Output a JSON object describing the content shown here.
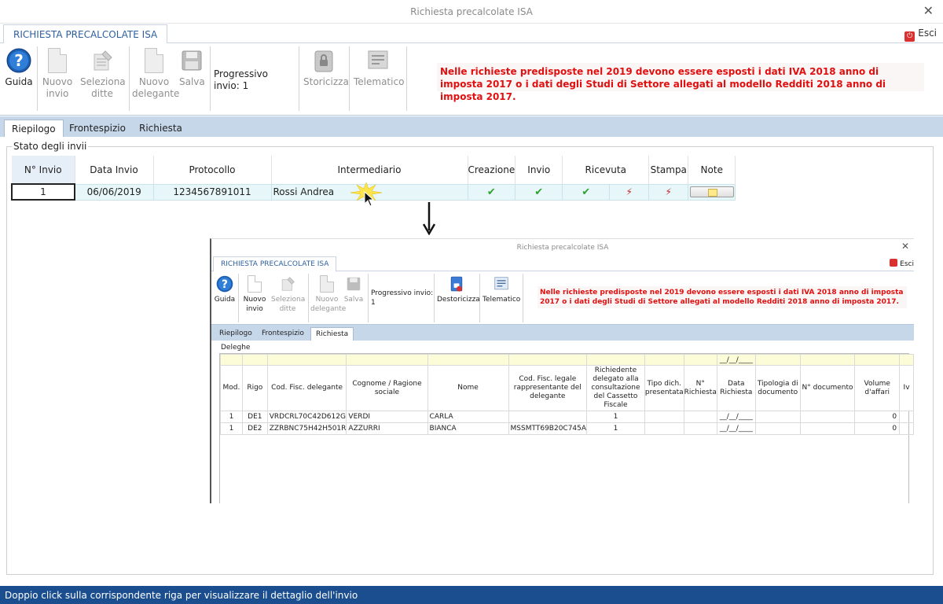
{
  "window": {
    "title": "Richiesta precalcolate ISA",
    "close": "✕"
  },
  "ribbon_tab": "RICHIESTA PRECALCOLATE ISA",
  "exit_label": "Esci",
  "toolbar": {
    "guida": "Guida",
    "nuovo_invio": [
      "Nuovo",
      "invio"
    ],
    "seleziona_ditte": [
      "Seleziona",
      "ditte"
    ],
    "nuovo_delegante": [
      "Nuovo",
      "delegante"
    ],
    "salva": "Salva",
    "progressivo": "Progressivo invio: 1",
    "storicizza": "Storicizza",
    "telematico": "Telematico"
  },
  "warning": "Nelle richieste predisposte nel 2019 devono essere esposti i dati IVA 2018 anno di imposta 2017 o i dati degli Studi di Settore allegati al modello Redditi 2018 anno di imposta 2017.",
  "tabs": [
    "Riepilogo",
    "Frontespizio",
    "Richiesta"
  ],
  "group_label": "Stato degli invii",
  "table": {
    "headers": [
      "N° Invio",
      "Data Invio",
      "Protocollo",
      "Intermediario",
      "Creazione",
      "Invio",
      "Ricevuta",
      "",
      "Stampa",
      "Note"
    ],
    "row": {
      "n": "1",
      "data": "06/06/2019",
      "protocollo": "1234567891011",
      "intermediario": "Rossi Andrea"
    }
  },
  "inner": {
    "title": "Richiesta precalcolate ISA",
    "ribbon_tab": "RICHIESTA PRECALCOLATE ISA",
    "exit_label": "Esci",
    "toolbar": {
      "guida": "Guida",
      "nuovo_invio": [
        "Nuovo",
        "invio"
      ],
      "seleziona_ditte": [
        "Seleziona",
        "ditte"
      ],
      "nuovo_delegante": [
        "Nuovo",
        "delegante"
      ],
      "salva": "Salva",
      "progressivo": "Progressivo invio: 1",
      "destoricizza": "Destoricizza",
      "telematico": "Telematico"
    },
    "warning": "Nelle richieste predisposte nel 2019 devono essere esposti i dati IVA 2018 anno di imposta 2017 o i dati degli Studi di Settore allegati al modello Redditi 2018 anno di imposta 2017.",
    "tabs": [
      "Riepilogo",
      "Frontespizio",
      "Richiesta"
    ],
    "group_label": "Deleghe",
    "date_placeholder": "__/__/____",
    "headers": [
      "Mod.",
      "Rigo",
      "Cod. Fisc. delegante",
      "Cognome / Ragione sociale",
      "Nome",
      "Cod. Fisc. legale rappresentante del delegante",
      "Richiedente delegato alla consultazione del Cassetto Fiscale",
      "Tipo dich. presentata",
      "N° Richiesta",
      "Data Richiesta",
      "Tipologia di documento",
      "N° documento",
      "Volume d'affari",
      "Iv"
    ],
    "rows": [
      {
        "mod": "1",
        "rigo": "DE1",
        "cf": "VRDCRL70C42D612G",
        "cognome": "VERDI",
        "nome": "CARLA",
        "cf_legale": "",
        "richiedente": "1",
        "data": "__/__/____",
        "volume": "0"
      },
      {
        "mod": "1",
        "rigo": "DE2",
        "cf": "ZZRBNC75H42H501R",
        "cognome": "AZZURRI",
        "nome": "BIANCA",
        "cf_legale": "MSSMTT69B20C745A",
        "richiedente": "1",
        "data": "__/__/____",
        "volume": "0"
      }
    ]
  },
  "status": "Doppio click sulla corrispondente riga per visualizzare il dettaglio dell'invio"
}
